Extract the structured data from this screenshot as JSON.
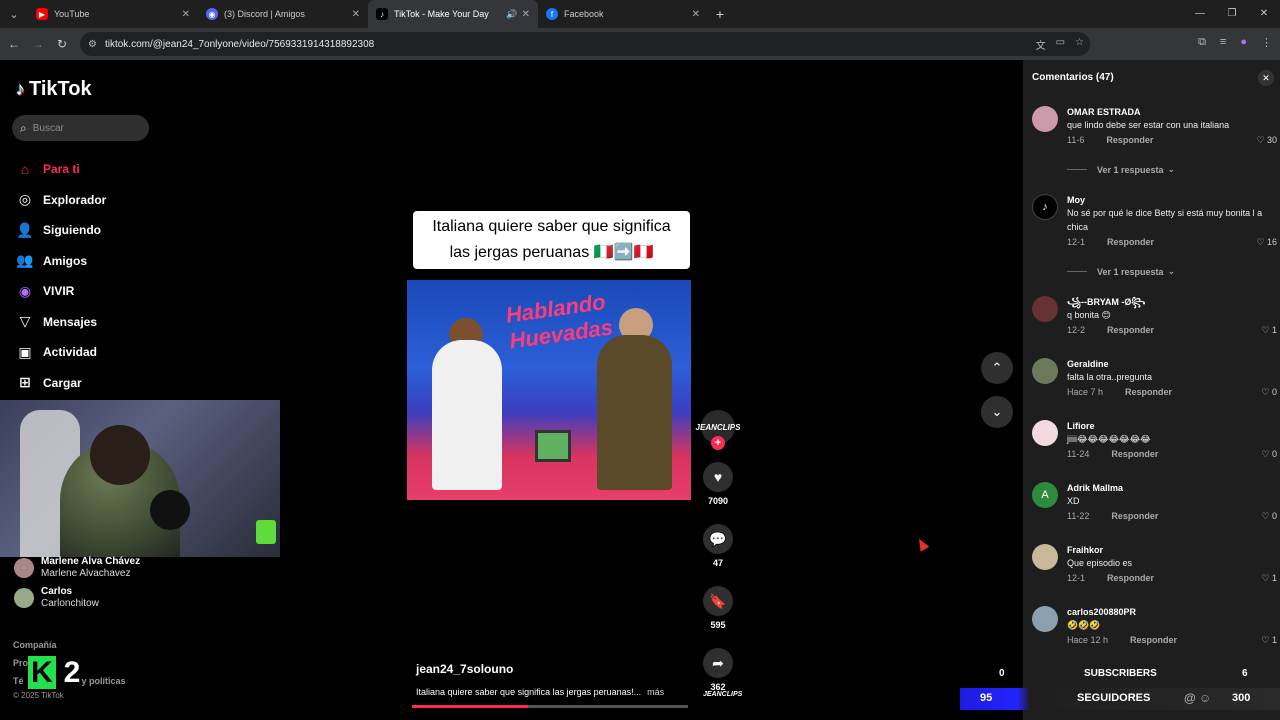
{
  "browser": {
    "tabs": [
      {
        "title": "YouTube",
        "favicon": "youtube-icon",
        "color": "#ff0000"
      },
      {
        "title": "(3) Discord | Amigos",
        "favicon": "discord-icon",
        "color": "#5865f2"
      },
      {
        "title": "TikTok - Make Your Day",
        "favicon": "tiktok-icon",
        "color": "#000000",
        "active": true
      },
      {
        "title": "Facebook",
        "favicon": "facebook-icon",
        "color": "#1877f2"
      }
    ],
    "url": "tiktok.com/@jean24_7onlyone/video/7569331914318892308"
  },
  "sidebar": {
    "logo": "TikTok",
    "search_placeholder": "Buscar",
    "nav": [
      {
        "label": "Para ti",
        "icon": "home-icon",
        "active": true
      },
      {
        "label": "Explorador",
        "icon": "compass-icon"
      },
      {
        "label": "Siguiendo",
        "icon": "user-plus-icon"
      },
      {
        "label": "Amigos",
        "icon": "users-icon"
      },
      {
        "label": "VIVIR",
        "icon": "live-icon"
      },
      {
        "label": "Mensajes",
        "icon": "send-icon"
      },
      {
        "label": "Actividad",
        "icon": "inbox-icon"
      },
      {
        "label": "Cargar",
        "icon": "upload-icon"
      }
    ],
    "following": [
      {
        "name": "Marlene Alva Chávez",
        "username": "Marlene Alvachavez"
      },
      {
        "name": "Carlos",
        "username": "Carlonchitow"
      }
    ],
    "footer": [
      "Compañía",
      "Pro",
      "Té",
      "© 2025 TikTok"
    ],
    "footer_fragment": "y políticas",
    "overlay": {
      "k": "K",
      "num": "2"
    }
  },
  "video": {
    "caption_line1": "Italiana quiere saber que significa",
    "caption_line2": "las jergas peruanas 🇮🇹➡️🇵🇪",
    "sign": "Hablando Huevadas",
    "author_avatar_text": "JEANCLIPS",
    "likes": "7090",
    "comments": "47",
    "saves": "595",
    "shares": "362",
    "author": "jean24_7solouno",
    "description": "Italiana quiere saber que significa las jergas peruanas!...",
    "more": "más",
    "progress": 0.42
  },
  "comments_panel": {
    "header": "Comentarios (47)",
    "view_replies": "Ver 1 respuesta",
    "reply_label": "Responder",
    "items": [
      {
        "name": "OMAR ESTRADA",
        "text": "que lindo debe ser estar con una italiana",
        "date": "11-6",
        "likes": "30"
      },
      {
        "name": "Moy",
        "text": "No sé por qué le dice Betty si está muy bonita l a chica",
        "date": "12-1",
        "likes": "16"
      },
      {
        "name": "꧁--BRYAM -Ø꧂",
        "text": "q bonita 😊",
        "date": "12-2",
        "likes": "1"
      },
      {
        "name": "Geraldine",
        "text": "falta la otra..pregunta",
        "date": "Hace 7 h",
        "likes": "0"
      },
      {
        "name": "Lifiore",
        "text": "jiiii😂😂😂😂😂😂😂",
        "date": "11-24",
        "likes": "0"
      },
      {
        "name": "Adrik Mallma",
        "text": "XD",
        "date": "11-22",
        "likes": "0",
        "initial": "A"
      },
      {
        "name": "Fraihkor",
        "text": "Que episodio es",
        "date": "12-1",
        "likes": "1"
      },
      {
        "name": "carlos200880PR",
        "text": "🤣🤣🤣",
        "date": "Hace 12 h",
        "likes": "1"
      }
    ]
  },
  "stats": {
    "subscribers_label": "SUBSCRIBERS",
    "subscribers_left": "0",
    "subscribers_right": "6",
    "followers_label": "SEGUIDORES",
    "followers_left": "95",
    "followers_right": "300"
  }
}
